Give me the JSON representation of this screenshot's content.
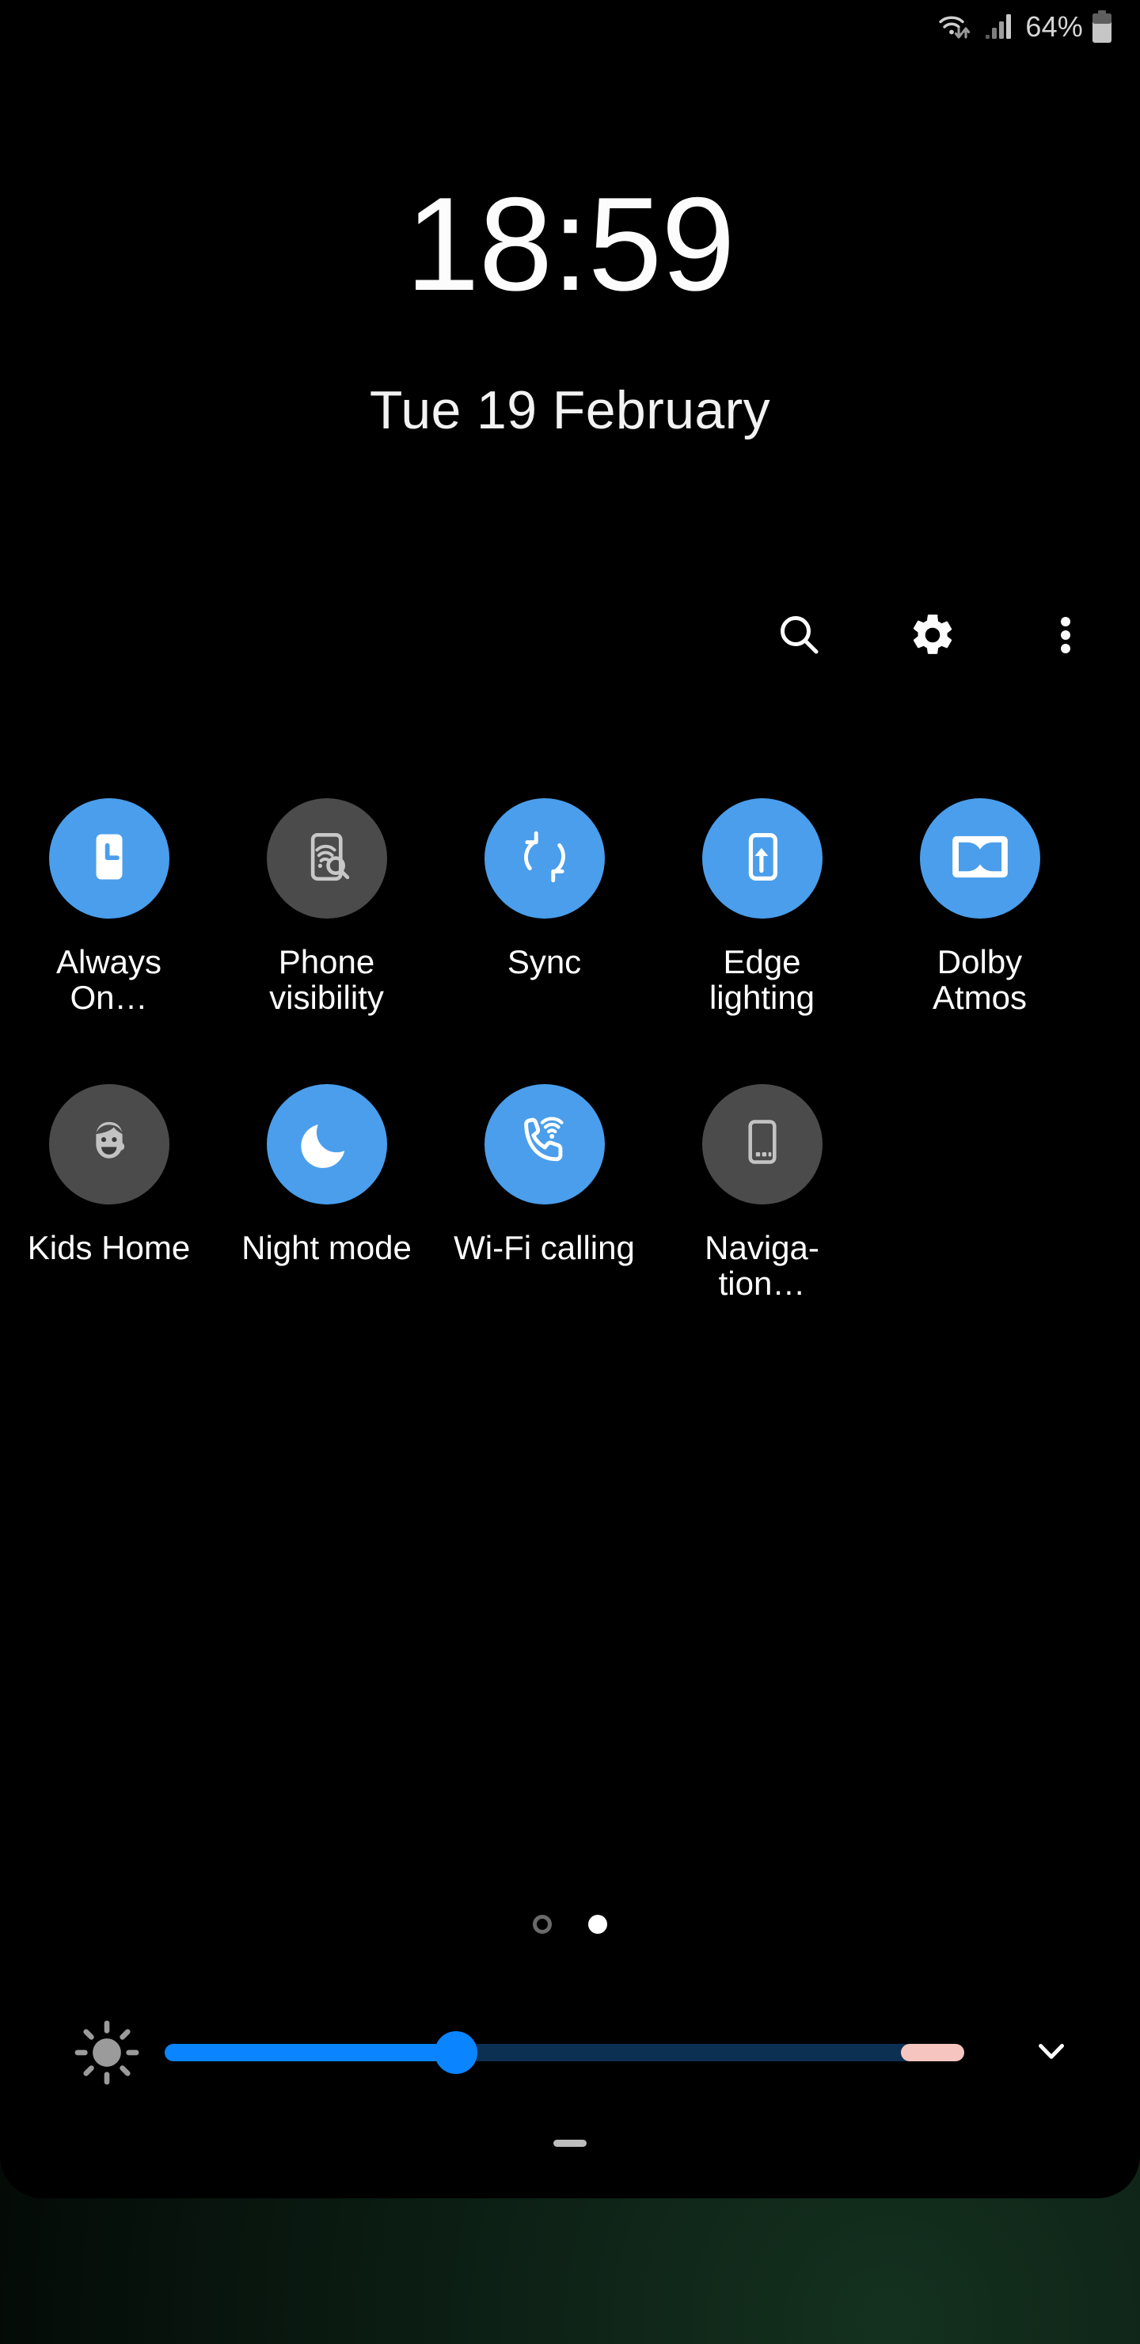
{
  "status_bar": {
    "wifi_icon": "wifi-with-transfer-arrows-icon",
    "signal_icon": "cellular-signal-icon",
    "battery_percent": "64%",
    "battery_icon": "battery-icon"
  },
  "lock_info": {
    "time": "18:59",
    "date": "Tue 19 February"
  },
  "header": {
    "actions": [
      {
        "name": "search-icon",
        "label": "Search"
      },
      {
        "name": "gear-icon",
        "label": "Settings"
      },
      {
        "name": "more-options-icon",
        "label": "More options"
      }
    ]
  },
  "quick_settings": {
    "tiles": [
      {
        "label": "Always On…",
        "icon": "always-on-display-icon",
        "state": "on"
      },
      {
        "label": "Phone visibility",
        "icon": "phone-visibility-icon",
        "state": "off"
      },
      {
        "label": "Sync",
        "icon": "sync-icon",
        "state": "on"
      },
      {
        "label": "Edge lighting",
        "icon": "edge-lighting-icon",
        "state": "on"
      },
      {
        "label": "Dolby Atmos",
        "icon": "dolby-atmos-icon",
        "state": "on"
      },
      {
        "label": "Kids Home",
        "icon": "kids-home-icon",
        "state": "off"
      },
      {
        "label": "Night mode",
        "icon": "night-mode-moon-icon",
        "state": "on"
      },
      {
        "label": "Wi-Fi calling",
        "icon": "wifi-calling-icon",
        "state": "on"
      },
      {
        "label": "Naviga-tion…",
        "icon": "navigation-bar-icon",
        "state": "off"
      }
    ]
  },
  "pagination": {
    "pages": 2,
    "current_page": 2
  },
  "brightness": {
    "icon": "brightness-sun-icon",
    "value_percent": 35,
    "expand_icon": "chevron-down-icon"
  },
  "colors": {
    "accent_on": "#4a9eec",
    "tile_off": "#4b4b4b",
    "slider_fill": "#0a84ff",
    "slider_track": "#0c3052",
    "slider_marker": "#f6c5c0",
    "background": "#000000"
  },
  "handle": {
    "name": "panel-drag-handle"
  }
}
